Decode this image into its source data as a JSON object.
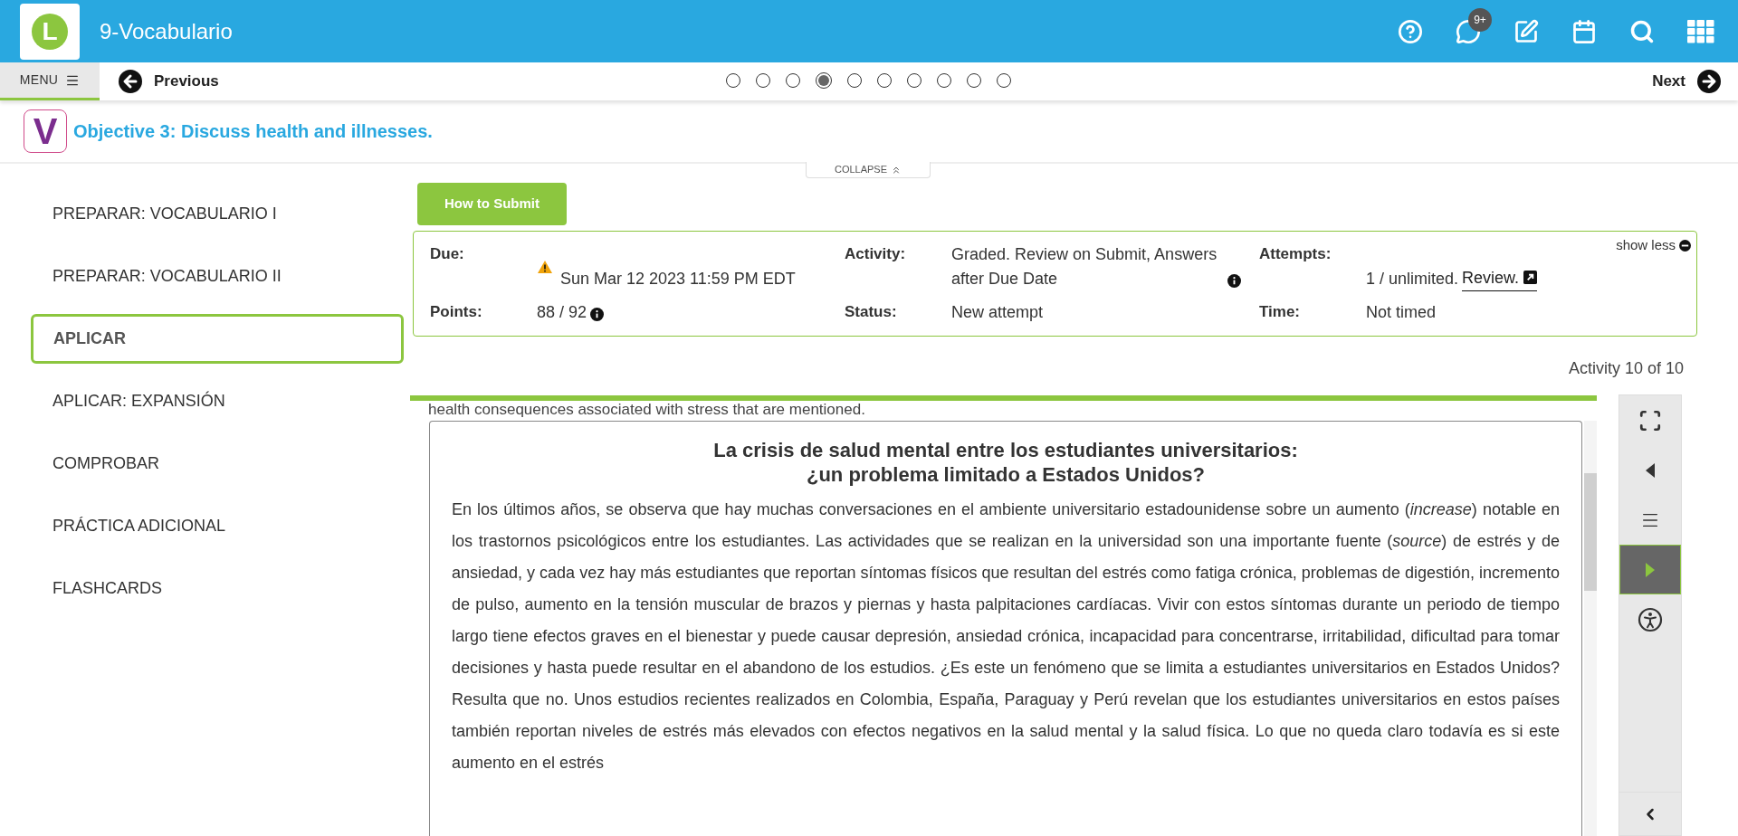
{
  "header": {
    "logo_letter": "L",
    "title": "9-Vocabulario",
    "notification_badge": "9+"
  },
  "nav": {
    "menu": "MENU",
    "previous": "Previous",
    "next": "Next",
    "pages": [
      {
        "selected": false
      },
      {
        "selected": false
      },
      {
        "selected": false
      },
      {
        "selected": true
      },
      {
        "selected": false
      },
      {
        "selected": false
      },
      {
        "selected": false
      },
      {
        "selected": false
      },
      {
        "selected": false
      },
      {
        "selected": false
      }
    ]
  },
  "objective": {
    "badge_letter": "V",
    "title": "Objective 3: Discuss health and illnesses."
  },
  "collapse": "COLLAPSE",
  "sidebar": {
    "items": [
      {
        "label": "PREPARAR: VOCABULARIO I",
        "selected": false
      },
      {
        "label": "PREPARAR: VOCABULARIO II",
        "selected": false
      },
      {
        "label": "APLICAR",
        "selected": true
      },
      {
        "label": "APLICAR: EXPANSIÓN",
        "selected": false
      },
      {
        "label": "COMPROBAR",
        "selected": false
      },
      {
        "label": "PRÁCTICA ADICIONAL",
        "selected": false
      },
      {
        "label": "FLASHCARDS",
        "selected": false
      }
    ]
  },
  "how_to_submit": "How to Submit",
  "info": {
    "show_less": "show less",
    "fields": [
      {
        "label": "Due:",
        "value": "Sun Mar 12 2023 11:59 PM EDT",
        "kind": "warning"
      },
      {
        "label": "Activity:",
        "value": "Graded. Review on Submit, Answers after Due Date",
        "kind": "info"
      },
      {
        "label": "Attempts:",
        "value": "1 / unlimited.",
        "link": "Review."
      },
      {
        "label": "Points:",
        "value": "88 / 92",
        "kind": "info"
      },
      {
        "label": "Status:",
        "value": "New attempt"
      },
      {
        "label": "Time:",
        "value": "Not timed"
      }
    ]
  },
  "activity_counter": "Activity 10 of 10",
  "reading": {
    "intro_fragment": "health consequences associated with stress that are mentioned.",
    "title_lines": [
      "La crisis de salud mental entre los estudiantes universitarios:",
      "¿un problema limitado a Estados Unidos?"
    ],
    "paragraph": "En los últimos años, se observa que hay muchas conversaciones en el ambiente universitario estadounidense sobre un aumento (*increase*) notable en los trastornos psicológicos entre los estudiantes. Las actividades que se realizan en la universidad son una importante fuente (*source*) de estrés y de ansiedad, y cada vez hay más estudiantes que reportan síntomas físicos que resultan del estrés como fatiga crónica, problemas de digestión, incremento de pulso, aumento en la tensión muscular de brazos y piernas y hasta palpitaciones cardíacas. Vivir con estos síntomas durante un periodo de tiempo largo tiene efectos graves en el bienestar y puede causar depresión, ansiedad crónica, incapacidad para concentrarse, irritabilidad, dificultad para tomar decisiones y hasta puede resultar en el abandono de los estudios. ¿Es este un fenómeno que se limita a estudiantes universitarios en Estados Unidos? Resulta que no. Unos estudios recientes realizados en Colombia, España, Paraguay y Perú revelan que los estudiantes universitarios en estos países también reportan niveles de estrés más elevados con efectos negativos en la salud mental y la salud física. Lo que no queda claro todavía es si este aumento en el estrés"
  },
  "tools": [
    {
      "kind": "fullscreen",
      "selected": false
    },
    {
      "kind": "back",
      "selected": false
    },
    {
      "kind": "menu",
      "selected": false
    },
    {
      "kind": "play",
      "selected": true
    },
    {
      "kind": "accessibility",
      "selected": false
    }
  ]
}
